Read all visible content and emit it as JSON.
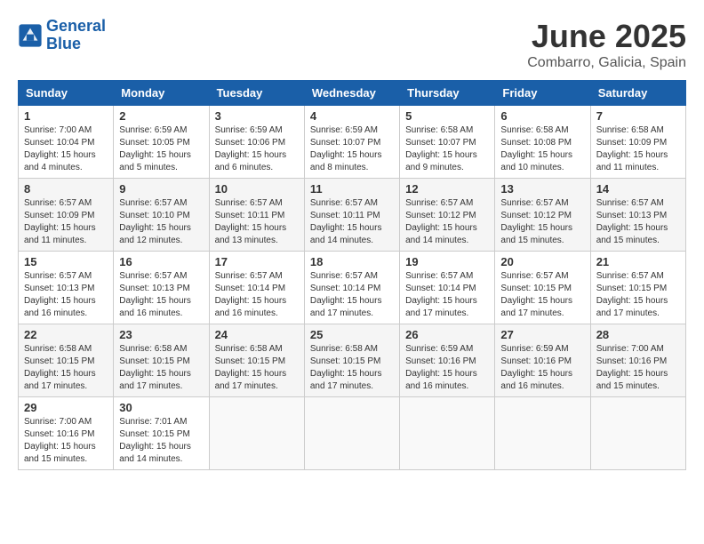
{
  "logo": {
    "line1": "General",
    "line2": "Blue"
  },
  "title": "June 2025",
  "location": "Combarro, Galicia, Spain",
  "headers": [
    "Sunday",
    "Monday",
    "Tuesday",
    "Wednesday",
    "Thursday",
    "Friday",
    "Saturday"
  ],
  "weeks": [
    [
      {
        "day": "1",
        "sunrise": "7:00 AM",
        "sunset": "10:04 PM",
        "daylight": "15 hours and 4 minutes."
      },
      {
        "day": "2",
        "sunrise": "6:59 AM",
        "sunset": "10:05 PM",
        "daylight": "15 hours and 5 minutes."
      },
      {
        "day": "3",
        "sunrise": "6:59 AM",
        "sunset": "10:06 PM",
        "daylight": "15 hours and 6 minutes."
      },
      {
        "day": "4",
        "sunrise": "6:59 AM",
        "sunset": "10:07 PM",
        "daylight": "15 hours and 8 minutes."
      },
      {
        "day": "5",
        "sunrise": "6:58 AM",
        "sunset": "10:07 PM",
        "daylight": "15 hours and 9 minutes."
      },
      {
        "day": "6",
        "sunrise": "6:58 AM",
        "sunset": "10:08 PM",
        "daylight": "15 hours and 10 minutes."
      },
      {
        "day": "7",
        "sunrise": "6:58 AM",
        "sunset": "10:09 PM",
        "daylight": "15 hours and 11 minutes."
      }
    ],
    [
      {
        "day": "8",
        "sunrise": "6:57 AM",
        "sunset": "10:09 PM",
        "daylight": "15 hours and 11 minutes."
      },
      {
        "day": "9",
        "sunrise": "6:57 AM",
        "sunset": "10:10 PM",
        "daylight": "15 hours and 12 minutes."
      },
      {
        "day": "10",
        "sunrise": "6:57 AM",
        "sunset": "10:11 PM",
        "daylight": "15 hours and 13 minutes."
      },
      {
        "day": "11",
        "sunrise": "6:57 AM",
        "sunset": "10:11 PM",
        "daylight": "15 hours and 14 minutes."
      },
      {
        "day": "12",
        "sunrise": "6:57 AM",
        "sunset": "10:12 PM",
        "daylight": "15 hours and 14 minutes."
      },
      {
        "day": "13",
        "sunrise": "6:57 AM",
        "sunset": "10:12 PM",
        "daylight": "15 hours and 15 minutes."
      },
      {
        "day": "14",
        "sunrise": "6:57 AM",
        "sunset": "10:13 PM",
        "daylight": "15 hours and 15 minutes."
      }
    ],
    [
      {
        "day": "15",
        "sunrise": "6:57 AM",
        "sunset": "10:13 PM",
        "daylight": "15 hours and 16 minutes."
      },
      {
        "day": "16",
        "sunrise": "6:57 AM",
        "sunset": "10:13 PM",
        "daylight": "15 hours and 16 minutes."
      },
      {
        "day": "17",
        "sunrise": "6:57 AM",
        "sunset": "10:14 PM",
        "daylight": "15 hours and 16 minutes."
      },
      {
        "day": "18",
        "sunrise": "6:57 AM",
        "sunset": "10:14 PM",
        "daylight": "15 hours and 17 minutes."
      },
      {
        "day": "19",
        "sunrise": "6:57 AM",
        "sunset": "10:14 PM",
        "daylight": "15 hours and 17 minutes."
      },
      {
        "day": "20",
        "sunrise": "6:57 AM",
        "sunset": "10:15 PM",
        "daylight": "15 hours and 17 minutes."
      },
      {
        "day": "21",
        "sunrise": "6:57 AM",
        "sunset": "10:15 PM",
        "daylight": "15 hours and 17 minutes."
      }
    ],
    [
      {
        "day": "22",
        "sunrise": "6:58 AM",
        "sunset": "10:15 PM",
        "daylight": "15 hours and 17 minutes."
      },
      {
        "day": "23",
        "sunrise": "6:58 AM",
        "sunset": "10:15 PM",
        "daylight": "15 hours and 17 minutes."
      },
      {
        "day": "24",
        "sunrise": "6:58 AM",
        "sunset": "10:15 PM",
        "daylight": "15 hours and 17 minutes."
      },
      {
        "day": "25",
        "sunrise": "6:58 AM",
        "sunset": "10:15 PM",
        "daylight": "15 hours and 17 minutes."
      },
      {
        "day": "26",
        "sunrise": "6:59 AM",
        "sunset": "10:16 PM",
        "daylight": "15 hours and 16 minutes."
      },
      {
        "day": "27",
        "sunrise": "6:59 AM",
        "sunset": "10:16 PM",
        "daylight": "15 hours and 16 minutes."
      },
      {
        "day": "28",
        "sunrise": "7:00 AM",
        "sunset": "10:16 PM",
        "daylight": "15 hours and 15 minutes."
      }
    ],
    [
      {
        "day": "29",
        "sunrise": "7:00 AM",
        "sunset": "10:16 PM",
        "daylight": "15 hours and 15 minutes."
      },
      {
        "day": "30",
        "sunrise": "7:01 AM",
        "sunset": "10:15 PM",
        "daylight": "15 hours and 14 minutes."
      },
      null,
      null,
      null,
      null,
      null
    ]
  ],
  "labels": {
    "sunrise": "Sunrise:",
    "sunset": "Sunset:",
    "daylight": "Daylight:"
  }
}
